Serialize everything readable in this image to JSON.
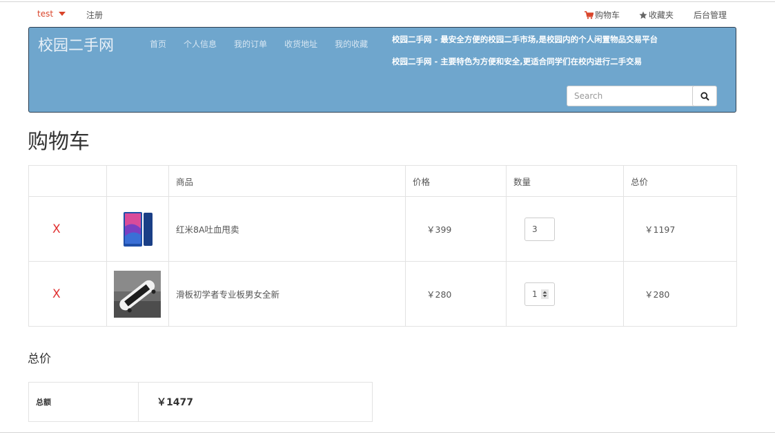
{
  "topbar": {
    "user": "test",
    "register": "注册",
    "cart": "购物车",
    "favorites": "收藏夹",
    "admin": "后台管理"
  },
  "header": {
    "brand": "校园二手网",
    "nav": [
      "首页",
      "个人信息",
      "我的订单",
      "收货地址",
      "我的收藏"
    ],
    "tagline1": "校园二手网 - 最安全方便的校园二手市场,是校园内的个人闲置物品交易平台",
    "tagline2": "校园二手网 - 主要特色为方便和安全,更适合同学们在校内进行二手交易",
    "search_placeholder": "Search"
  },
  "page_title": "购物车",
  "cart": {
    "columns": [
      "",
      "",
      "商品",
      "价格",
      "数量",
      "总价"
    ],
    "delete_symbol": "X",
    "rows": [
      {
        "name": "红米8A吐血甩卖",
        "price": "￥399",
        "qty": "3",
        "subtotal": "￥1197"
      },
      {
        "name": "滑板初学者专业板男女全新",
        "price": "￥280",
        "qty": "1",
        "subtotal": "￥280"
      }
    ]
  },
  "total": {
    "title": "总价",
    "label": "总额",
    "value": "￥1477"
  },
  "colors": {
    "banner": "#6fa6cd",
    "accent": "#d9442a",
    "delete": "#e03030"
  }
}
